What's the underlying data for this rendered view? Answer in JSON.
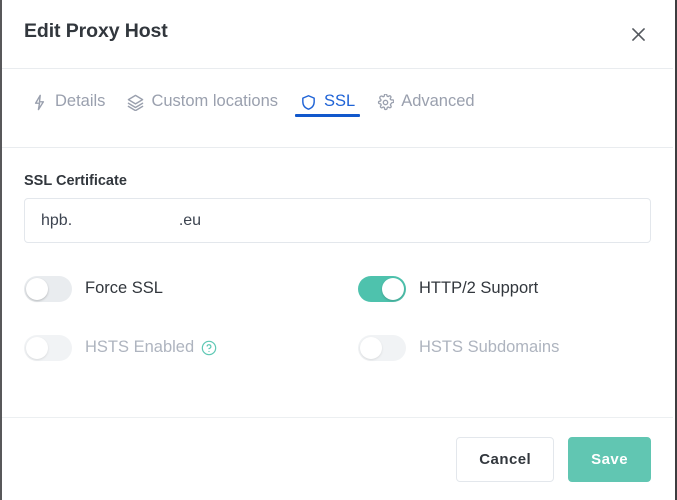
{
  "window": {
    "title": "Edit Proxy Host",
    "close_icon": "close-icon"
  },
  "tabs": [
    {
      "id": "details",
      "label": "Details",
      "icon": "zap-icon",
      "active": false
    },
    {
      "id": "custom-locations",
      "label": "Custom locations",
      "icon": "layers-icon",
      "active": false
    },
    {
      "id": "ssl",
      "label": "SSL",
      "icon": "shield-icon",
      "active": true
    },
    {
      "id": "advanced",
      "label": "Advanced",
      "icon": "settings-icon",
      "active": false
    }
  ],
  "ssl": {
    "section_label": "SSL Certificate",
    "certificate": {
      "value": "hpb.                        .eu",
      "placeholder": "hpb.                        .eu"
    },
    "toggles": [
      {
        "id": "force-ssl",
        "label": "Force SSL",
        "on": false,
        "disabled": false,
        "help": false
      },
      {
        "id": "http2-support",
        "label": "HTTP/2 Support",
        "on": true,
        "disabled": false,
        "help": false
      },
      {
        "id": "hsts-enabled",
        "label": "HSTS Enabled",
        "on": false,
        "disabled": true,
        "help": true,
        "help_icon": "help-circle-icon"
      },
      {
        "id": "hsts-subdomains",
        "label": "HSTS Subdomains",
        "on": false,
        "disabled": true,
        "help": false
      }
    ]
  },
  "footer": {
    "cancel_label": "Cancel",
    "save_label": "Save"
  },
  "colors": {
    "accent_blue": "#1158cc",
    "accent_teal": "#4ec2ad",
    "save_teal": "#61c6b2",
    "text_dark": "#32373d",
    "text_muted": "#9aa0ae",
    "border": "#e3e7ec"
  }
}
